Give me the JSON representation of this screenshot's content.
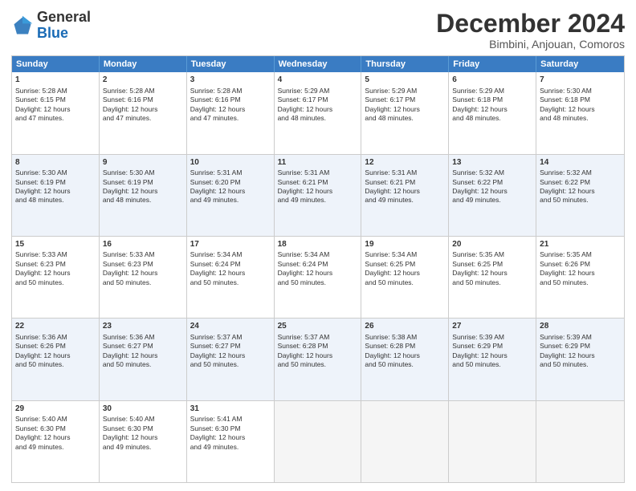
{
  "header": {
    "logo_general": "General",
    "logo_blue": "Blue",
    "month_title": "December 2024",
    "subtitle": "Bimbini, Anjouan, Comoros"
  },
  "days_of_week": [
    "Sunday",
    "Monday",
    "Tuesday",
    "Wednesday",
    "Thursday",
    "Friday",
    "Saturday"
  ],
  "weeks": [
    {
      "alt": false,
      "days": [
        {
          "num": "1",
          "lines": [
            "Sunrise: 5:28 AM",
            "Sunset: 6:15 PM",
            "Daylight: 12 hours",
            "and 47 minutes."
          ]
        },
        {
          "num": "2",
          "lines": [
            "Sunrise: 5:28 AM",
            "Sunset: 6:16 PM",
            "Daylight: 12 hours",
            "and 47 minutes."
          ]
        },
        {
          "num": "3",
          "lines": [
            "Sunrise: 5:28 AM",
            "Sunset: 6:16 PM",
            "Daylight: 12 hours",
            "and 47 minutes."
          ]
        },
        {
          "num": "4",
          "lines": [
            "Sunrise: 5:29 AM",
            "Sunset: 6:17 PM",
            "Daylight: 12 hours",
            "and 48 minutes."
          ]
        },
        {
          "num": "5",
          "lines": [
            "Sunrise: 5:29 AM",
            "Sunset: 6:17 PM",
            "Daylight: 12 hours",
            "and 48 minutes."
          ]
        },
        {
          "num": "6",
          "lines": [
            "Sunrise: 5:29 AM",
            "Sunset: 6:18 PM",
            "Daylight: 12 hours",
            "and 48 minutes."
          ]
        },
        {
          "num": "7",
          "lines": [
            "Sunrise: 5:30 AM",
            "Sunset: 6:18 PM",
            "Daylight: 12 hours",
            "and 48 minutes."
          ]
        }
      ]
    },
    {
      "alt": true,
      "days": [
        {
          "num": "8",
          "lines": [
            "Sunrise: 5:30 AM",
            "Sunset: 6:19 PM",
            "Daylight: 12 hours",
            "and 48 minutes."
          ]
        },
        {
          "num": "9",
          "lines": [
            "Sunrise: 5:30 AM",
            "Sunset: 6:19 PM",
            "Daylight: 12 hours",
            "and 48 minutes."
          ]
        },
        {
          "num": "10",
          "lines": [
            "Sunrise: 5:31 AM",
            "Sunset: 6:20 PM",
            "Daylight: 12 hours",
            "and 49 minutes."
          ]
        },
        {
          "num": "11",
          "lines": [
            "Sunrise: 5:31 AM",
            "Sunset: 6:21 PM",
            "Daylight: 12 hours",
            "and 49 minutes."
          ]
        },
        {
          "num": "12",
          "lines": [
            "Sunrise: 5:31 AM",
            "Sunset: 6:21 PM",
            "Daylight: 12 hours",
            "and 49 minutes."
          ]
        },
        {
          "num": "13",
          "lines": [
            "Sunrise: 5:32 AM",
            "Sunset: 6:22 PM",
            "Daylight: 12 hours",
            "and 49 minutes."
          ]
        },
        {
          "num": "14",
          "lines": [
            "Sunrise: 5:32 AM",
            "Sunset: 6:22 PM",
            "Daylight: 12 hours",
            "and 50 minutes."
          ]
        }
      ]
    },
    {
      "alt": false,
      "days": [
        {
          "num": "15",
          "lines": [
            "Sunrise: 5:33 AM",
            "Sunset: 6:23 PM",
            "Daylight: 12 hours",
            "and 50 minutes."
          ]
        },
        {
          "num": "16",
          "lines": [
            "Sunrise: 5:33 AM",
            "Sunset: 6:23 PM",
            "Daylight: 12 hours",
            "and 50 minutes."
          ]
        },
        {
          "num": "17",
          "lines": [
            "Sunrise: 5:34 AM",
            "Sunset: 6:24 PM",
            "Daylight: 12 hours",
            "and 50 minutes."
          ]
        },
        {
          "num": "18",
          "lines": [
            "Sunrise: 5:34 AM",
            "Sunset: 6:24 PM",
            "Daylight: 12 hours",
            "and 50 minutes."
          ]
        },
        {
          "num": "19",
          "lines": [
            "Sunrise: 5:34 AM",
            "Sunset: 6:25 PM",
            "Daylight: 12 hours",
            "and 50 minutes."
          ]
        },
        {
          "num": "20",
          "lines": [
            "Sunrise: 5:35 AM",
            "Sunset: 6:25 PM",
            "Daylight: 12 hours",
            "and 50 minutes."
          ]
        },
        {
          "num": "21",
          "lines": [
            "Sunrise: 5:35 AM",
            "Sunset: 6:26 PM",
            "Daylight: 12 hours",
            "and 50 minutes."
          ]
        }
      ]
    },
    {
      "alt": true,
      "days": [
        {
          "num": "22",
          "lines": [
            "Sunrise: 5:36 AM",
            "Sunset: 6:26 PM",
            "Daylight: 12 hours",
            "and 50 minutes."
          ]
        },
        {
          "num": "23",
          "lines": [
            "Sunrise: 5:36 AM",
            "Sunset: 6:27 PM",
            "Daylight: 12 hours",
            "and 50 minutes."
          ]
        },
        {
          "num": "24",
          "lines": [
            "Sunrise: 5:37 AM",
            "Sunset: 6:27 PM",
            "Daylight: 12 hours",
            "and 50 minutes."
          ]
        },
        {
          "num": "25",
          "lines": [
            "Sunrise: 5:37 AM",
            "Sunset: 6:28 PM",
            "Daylight: 12 hours",
            "and 50 minutes."
          ]
        },
        {
          "num": "26",
          "lines": [
            "Sunrise: 5:38 AM",
            "Sunset: 6:28 PM",
            "Daylight: 12 hours",
            "and 50 minutes."
          ]
        },
        {
          "num": "27",
          "lines": [
            "Sunrise: 5:39 AM",
            "Sunset: 6:29 PM",
            "Daylight: 12 hours",
            "and 50 minutes."
          ]
        },
        {
          "num": "28",
          "lines": [
            "Sunrise: 5:39 AM",
            "Sunset: 6:29 PM",
            "Daylight: 12 hours",
            "and 50 minutes."
          ]
        }
      ]
    },
    {
      "alt": false,
      "days": [
        {
          "num": "29",
          "lines": [
            "Sunrise: 5:40 AM",
            "Sunset: 6:30 PM",
            "Daylight: 12 hours",
            "and 49 minutes."
          ]
        },
        {
          "num": "30",
          "lines": [
            "Sunrise: 5:40 AM",
            "Sunset: 6:30 PM",
            "Daylight: 12 hours",
            "and 49 minutes."
          ]
        },
        {
          "num": "31",
          "lines": [
            "Sunrise: 5:41 AM",
            "Sunset: 6:30 PM",
            "Daylight: 12 hours",
            "and 49 minutes."
          ]
        },
        {
          "num": "",
          "lines": []
        },
        {
          "num": "",
          "lines": []
        },
        {
          "num": "",
          "lines": []
        },
        {
          "num": "",
          "lines": []
        }
      ]
    }
  ]
}
